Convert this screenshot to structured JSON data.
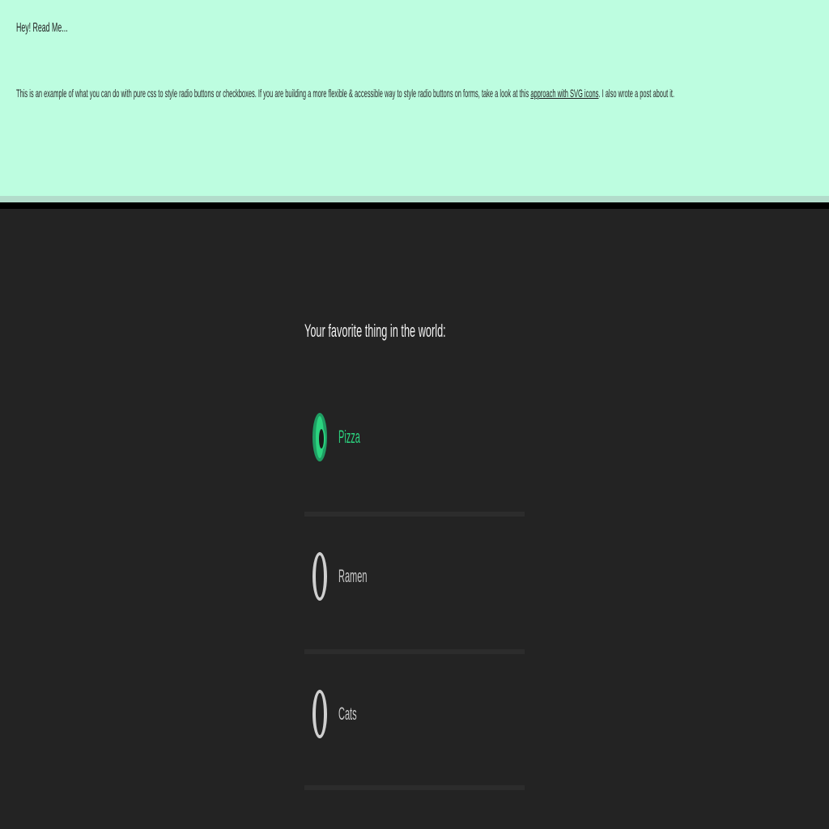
{
  "notice": {
    "title": "Hey! Read Me...",
    "body_text": "This is an example of what you can do with pure css to style radio buttons or checkboxes. If you are building a more flexible & accessible way to style radio buttons on forms, take a look at this",
    "link_text": "approach with SVG icons",
    "body_text_end": ". I also wrote a post about it.",
    "background": "#bdfde0"
  },
  "form": {
    "legend": "Your favorite thing in the world:",
    "options": [
      {
        "label": "Pizza",
        "checked": true
      },
      {
        "label": "Ramen",
        "checked": false
      },
      {
        "label": "Cats",
        "checked": false
      }
    ],
    "accent": "#2bd47f"
  }
}
